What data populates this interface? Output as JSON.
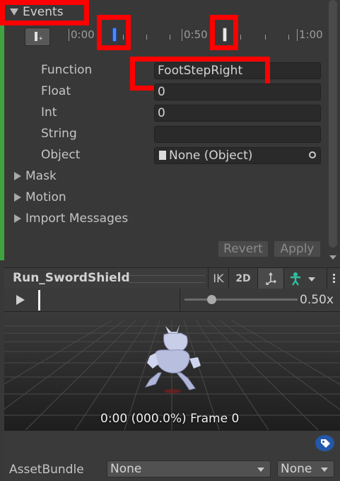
{
  "events_section": {
    "header": "Events",
    "timeline_labels": [
      "0:00",
      "0:50",
      "1:00"
    ]
  },
  "properties": [
    {
      "label": "Function",
      "value": "FootStepRight"
    },
    {
      "label": "Float",
      "value": "0"
    },
    {
      "label": "Int",
      "value": "0"
    },
    {
      "label": "String",
      "value": ""
    },
    {
      "label": "Object",
      "value": "None (Object)"
    }
  ],
  "sections": [
    "Mask",
    "Motion",
    "Import Messages"
  ],
  "buttons": {
    "revert": "Revert",
    "apply": "Apply"
  },
  "preview": {
    "clip_name": "Run_SwordShield",
    "ik_label": "IK",
    "mode_2d_label": "2D",
    "speed": "0.50x",
    "status": "0:00 (000.0%) Frame 0"
  },
  "asset_bundle": {
    "label": "AssetBundle",
    "name_value": "None",
    "variant_value": "None"
  },
  "colors": {
    "highlight": "#ff0000",
    "selected_marker": "#4a8cff",
    "inspector_bg": "#383838"
  },
  "icons": [
    "add-event-icon",
    "object-picker-icon",
    "play-icon",
    "move-tool-icon",
    "avatar-icon",
    "tag-icon",
    "more-menu-icon"
  ]
}
